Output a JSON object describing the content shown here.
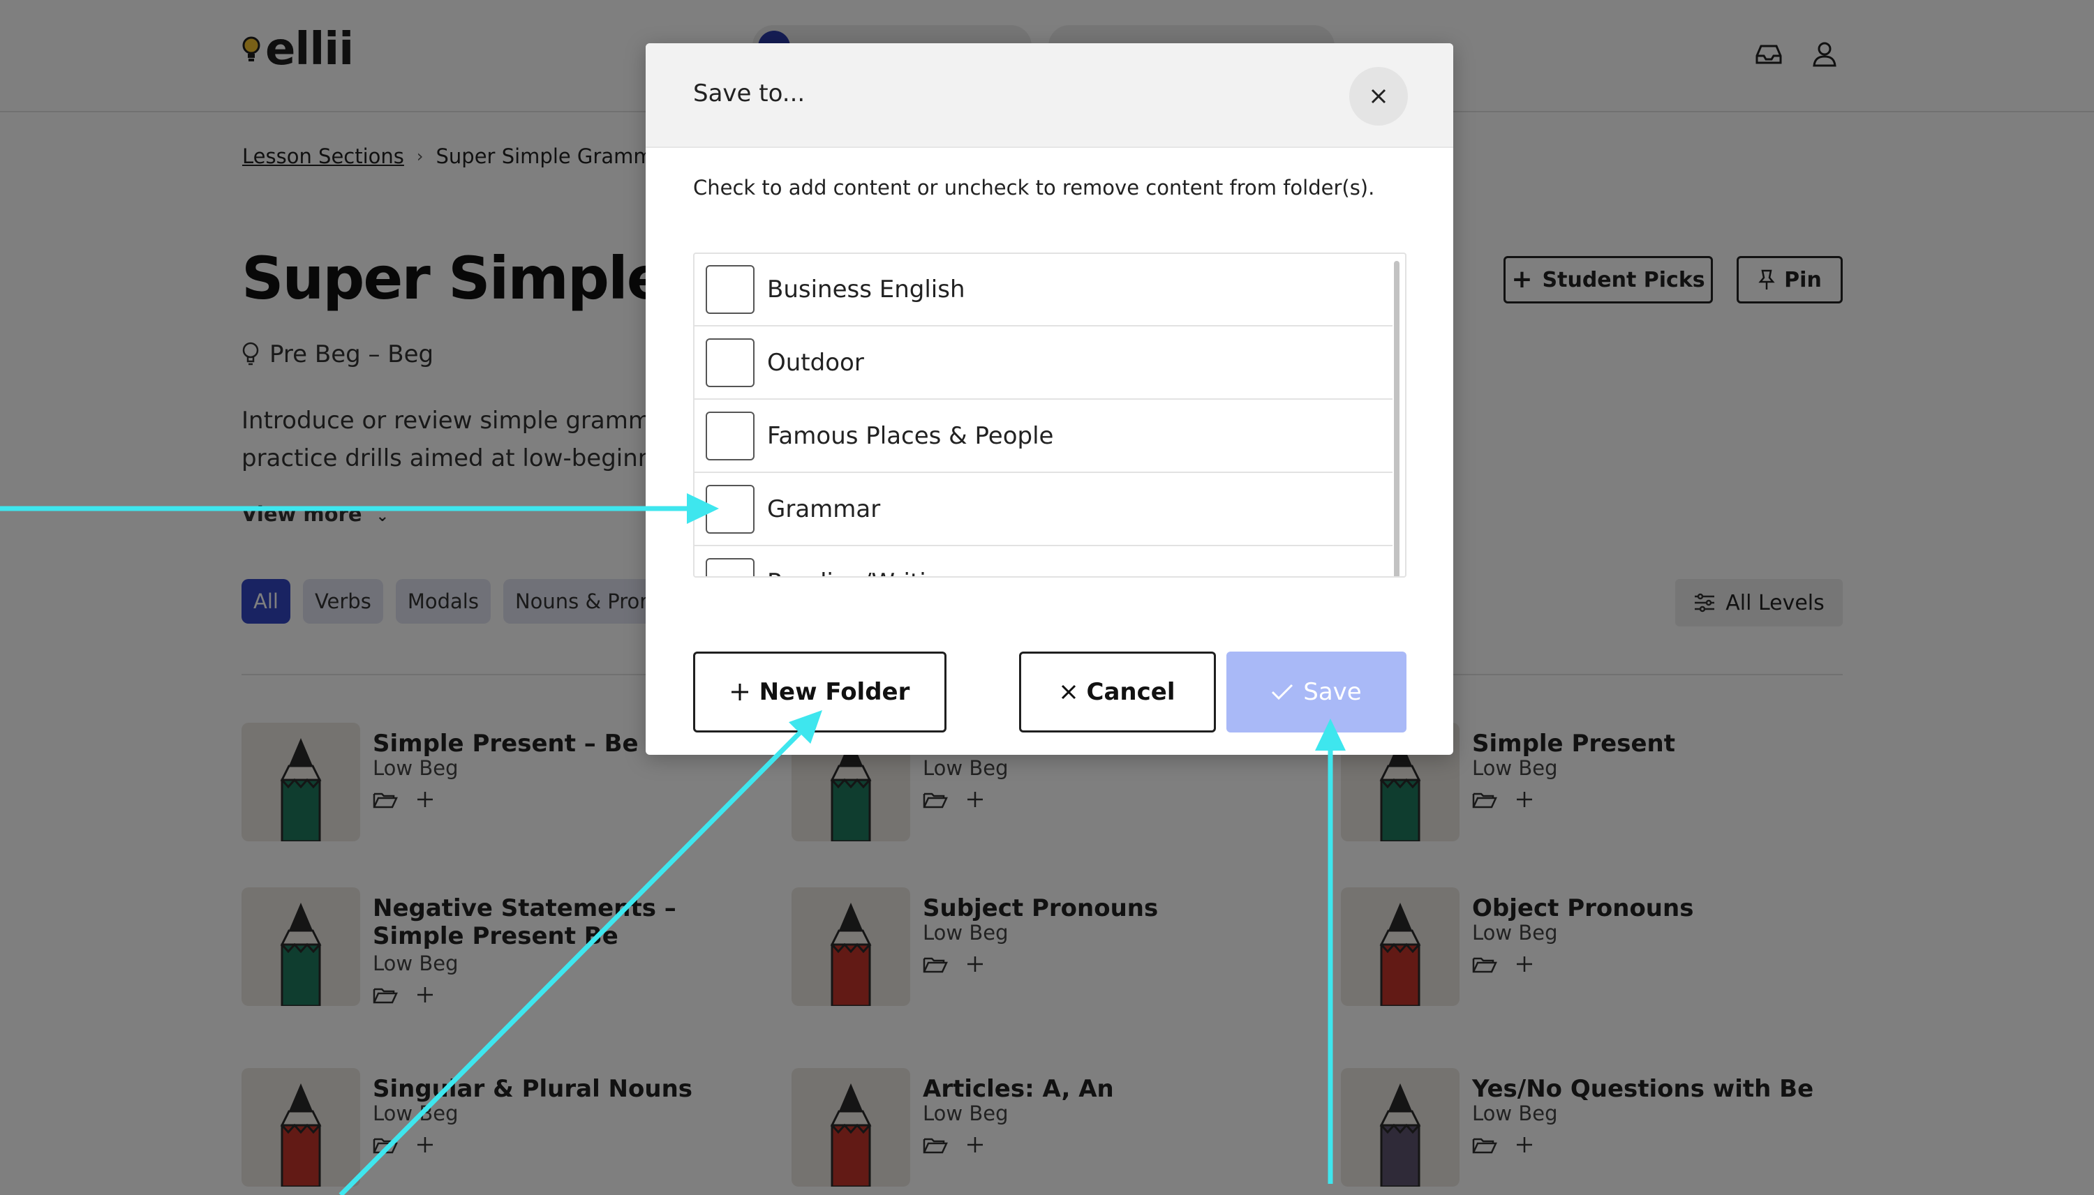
{
  "header": {
    "logo_text": "ellii",
    "icons": [
      "inbox-icon",
      "user-icon"
    ]
  },
  "breadcrumb": {
    "root_label": "Lesson Sections",
    "current_label": "Super Simple Grammar"
  },
  "page": {
    "title": "Super Simple Grammar",
    "level": "Pre Beg – Beg",
    "intro_line1": "Introduce or review simple grammar",
    "intro_line2": "practice drills aimed at low-beginner",
    "view_more": "View more",
    "student_picks_label": "Student Picks",
    "pin_label": "Pin",
    "all_levels_label": "All Levels"
  },
  "filters": [
    "All",
    "Verbs",
    "Modals",
    "Nouns & Pronouns"
  ],
  "lessons": [
    {
      "title": "Simple Present – Be",
      "level": "Low Beg",
      "pencil_color": "#1e7a5e"
    },
    {
      "title": "",
      "level": "Low Beg",
      "pencil_color": "#1e7a5e"
    },
    {
      "title": "Simple Present",
      "level": "Low Beg",
      "pencil_color": "#1e7a5e"
    },
    {
      "title": "Negative Statements – Simple Present Be",
      "level": "Low Beg",
      "pencil_color": "#1e7a5e"
    },
    {
      "title": "Subject Pronouns",
      "level": "Low Beg",
      "pencil_color": "#c5352b"
    },
    {
      "title": "Object Pronouns",
      "level": "Low Beg",
      "pencil_color": "#c5352b"
    },
    {
      "title": "Singular & Plural Nouns",
      "level": "Low Beg",
      "pencil_color": "#c5352b"
    },
    {
      "title": "Articles: A, An",
      "level": "Low Beg",
      "pencil_color": "#c5352b"
    },
    {
      "title": "Yes/No Questions with Be",
      "level": "Low Beg",
      "pencil_color": "#5f5470"
    }
  ],
  "modal": {
    "title": "Save to...",
    "description": "Check to add content or uncheck to remove content from folder(s).",
    "folders": [
      {
        "label": "Business English",
        "checked": false
      },
      {
        "label": "Outdoor",
        "checked": false
      },
      {
        "label": "Famous Places & People",
        "checked": false
      },
      {
        "label": "Grammar",
        "checked": false
      },
      {
        "label": "Reading/Writing",
        "checked": false
      }
    ],
    "new_folder_label": "New Folder",
    "cancel_label": "Cancel",
    "save_label": "Save"
  },
  "colors": {
    "annotation_arrow": "#3ee6ee",
    "save_button": "#a9b9f7",
    "chip_active": "#3346c4"
  }
}
